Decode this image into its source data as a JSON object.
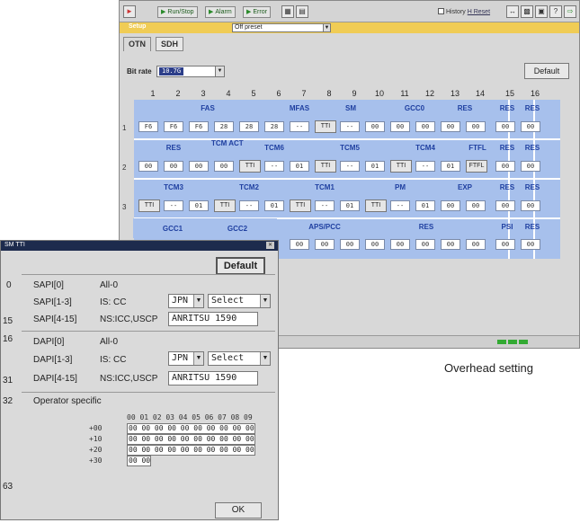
{
  "toolbar": {
    "run_stop": "Run/Stop",
    "alarm": "Alarm",
    "error": "Error",
    "history_label": "History",
    "reset_label": "H Reset"
  },
  "setup": {
    "title": "Setup",
    "preset": "Off preset"
  },
  "tabs": [
    "OTN",
    "SDH"
  ],
  "bitrate": {
    "label": "Bit rate",
    "value": "10.7G"
  },
  "default_label": "Default",
  "columns": [
    "1",
    "2",
    "3",
    "4",
    "5",
    "6",
    "7",
    "8",
    "9",
    "10",
    "11",
    "12",
    "13",
    "14",
    "15",
    "16"
  ],
  "rows": {
    "r1": {
      "num": "1",
      "labels": {
        "fas": "FAS",
        "mfas": "MFAS",
        "sm": "SM",
        "gcc0": "GCC0",
        "res_a": "RES",
        "res_b": "RES",
        "res_c": "RES"
      },
      "cells": [
        "F6",
        "F6",
        "F6",
        "28",
        "28",
        "28",
        "--",
        "TTI",
        "--",
        "00",
        "00",
        "00",
        "00",
        "00",
        "00",
        "00"
      ]
    },
    "r2": {
      "num": "2",
      "labels": {
        "res": "RES",
        "tcm_act": "TCM ACT",
        "tcm6": "TCM6",
        "tcm5": "TCM5",
        "tcm4": "TCM4",
        "ftfl": "FTFL",
        "res_b": "RES",
        "res_c": "RES"
      },
      "cells": [
        "00",
        "00",
        "00",
        "00",
        "TTI",
        "--",
        "01",
        "TTI",
        "--",
        "01",
        "TTI",
        "--",
        "01",
        "FTFL",
        "00",
        "00"
      ]
    },
    "r3": {
      "num": "3",
      "labels": {
        "tcm3": "TCM3",
        "tcm2": "TCM2",
        "tcm1": "TCM1",
        "pm": "PM",
        "exp": "EXP",
        "res_b": "RES",
        "res_c": "RES"
      },
      "cells": [
        "TTI",
        "--",
        "01",
        "TTI",
        "--",
        "01",
        "TTI",
        "--",
        "01",
        "TTI",
        "--",
        "01",
        "00",
        "00",
        "00",
        "00"
      ]
    },
    "r4": {
      "labels": {
        "gcc1": "GCC1",
        "gcc2": "GCC2",
        "apspcc": "APS/PCC",
        "res": "RES",
        "psi": "PSI",
        "res_c": "RES"
      },
      "cells": [
        "00",
        "00",
        "00",
        "00",
        "00",
        "00",
        "00",
        "00",
        "00",
        "00"
      ]
    }
  },
  "caption": "Overhead setting",
  "dialog": {
    "title": "SM TTI",
    "default_label": "Default",
    "ok_label": "OK",
    "sapi": {
      "num_start": "0",
      "num_end": "15",
      "f0_label": "SAPI[0]",
      "f0_value": "All-0",
      "f1_label": "SAPI[1-3]",
      "f1_value": "IS: CC",
      "f1_country": "JPN",
      "f1_select": "Select",
      "f2_label": "SAPI[4-15]",
      "f2_value": "NS:ICC,USCP",
      "f2_text": "ANRITSU 1590"
    },
    "dapi": {
      "num_start": "16",
      "num_end": "31",
      "f0_label": "DAPI[0]",
      "f0_value": "All-0",
      "f1_label": "DAPI[1-3]",
      "f1_value": "IS: CC",
      "f1_country": "JPN",
      "f1_select": "Select",
      "f2_label": "DAPI[4-15]",
      "f2_value": "NS:ICC,USCP",
      "f2_text": "ANRITSU 1590"
    },
    "operator": {
      "num_start": "32",
      "num_end": "63",
      "label": "Operator specific",
      "header": "00 01 02 03 04 05 06 07 08 09",
      "rows": [
        {
          "label": "+00",
          "value": "00 00 00 00 00 00 00 00 00 00"
        },
        {
          "label": "+10",
          "value": "00 00 00 00 00 00 00 00 00 00"
        },
        {
          "label": "+20",
          "value": "00 00 00 00 00 00 00 00 00 00"
        },
        {
          "label": "+30",
          "value": "00 00"
        }
      ]
    }
  },
  "colors": {
    "grid_blue": "#a7c0ec",
    "label_blue": "#1f3fa0",
    "title_bar": "#f0cc55",
    "dialog_title": "#1d2b4d",
    "led_green": "#33aa33"
  }
}
